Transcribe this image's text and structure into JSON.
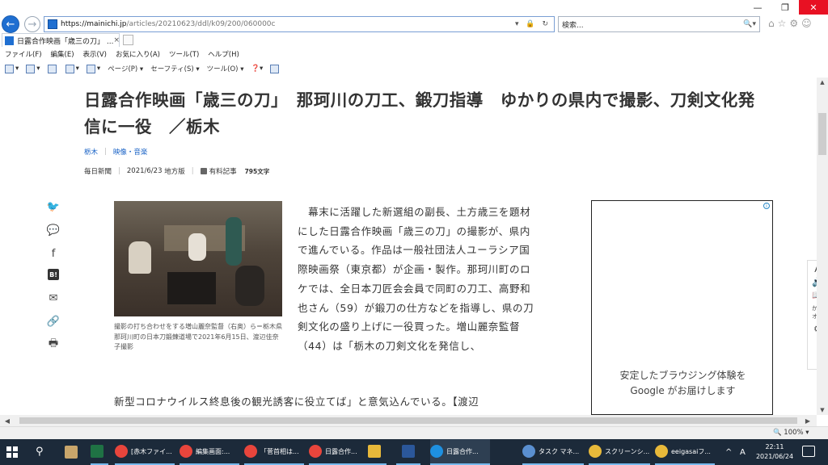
{
  "browser": {
    "url_domain": "https://mainichi.jp",
    "url_path": "/articles/20210623/ddl/k09/200/060000c",
    "url_controls": "▾ 🔒 ↻",
    "search_placeholder": "検索...",
    "tab_title": "日露合作映画「歳三の刀」 ...",
    "tab_close": "×",
    "menu": [
      "ファイル(F)",
      "編集(E)",
      "表示(V)",
      "お気に入り(A)",
      "ツール(T)",
      "ヘルプ(H)"
    ],
    "commands": [
      "ページ(P) ▾",
      "セーフティ(S) ▾",
      "ツール(O) ▾"
    ],
    "zoom": "100%"
  },
  "article": {
    "headline": "日露合作映画「歳三の刀」　那珂川の刀工、鍛刀指導　ゆかりの県内で撮影、刀剣文化発信に一役　／栃木",
    "categories": [
      "栃木",
      "映像・音楽"
    ],
    "source": "毎日新聞",
    "date": "2021/6/23",
    "edition": "地方版",
    "paid_label": "有料記事",
    "char_count": "795文字",
    "caption": "撮影の打ち合わせをする増山麗奈監督（右奥）ら＝栃木県那珂川町の日本刀鍛錬道場で2021年6月15日、渡辺佳奈子撮影",
    "body_para": "　幕末に活躍した新選組の副長、土方歳三を題材にした日露合作映画「歳三の刀」の撮影が、県内で進んでいる。作品は一般社団法人ユーラシア国際映画祭（東京都）が企画・製作。那珂川町のロケでは、全日本刀匠会会員で同町の刀工、高野和也さん（59）が鍛刀の仕方などを指導し、県の刀剣文化の盛り上げに一役買った。増山麗奈監督（44）は「栃木の刀剣文化を発信し、",
    "body_cont": "新型コロナウイルス終息後の観光誘客に役立てば」と意気込んでいる。【渡辺"
  },
  "ad": {
    "info_icon": "i",
    "text_line1": "安定したブラウジング体験を",
    "text_line2": "Google がお届けします"
  },
  "float_toolbar": {
    "font_label": "A",
    "kana_label": "かな\nオフ"
  },
  "taskbar": {
    "items": [
      {
        "label": "[赤木ファイ...",
        "color": "#e8453c"
      },
      {
        "label": "編集画面:...",
        "color": "#e8453c"
      },
      {
        "label": "「菅首相は...",
        "color": "#e8453c"
      },
      {
        "label": "日露合作...",
        "color": "#e8453c"
      },
      {
        "label": "日露合作...",
        "color": "#1e90e0"
      },
      {
        "label": "タスク マネ...",
        "color": "#5a8fd0"
      },
      {
        "label": "スクリーンシ...",
        "color": "#e8b93a"
      },
      {
        "label": "eeigasaiフ...",
        "color": "#e8b93a"
      }
    ],
    "ime": "A",
    "time": "22:11",
    "date": "2021/06/24"
  }
}
